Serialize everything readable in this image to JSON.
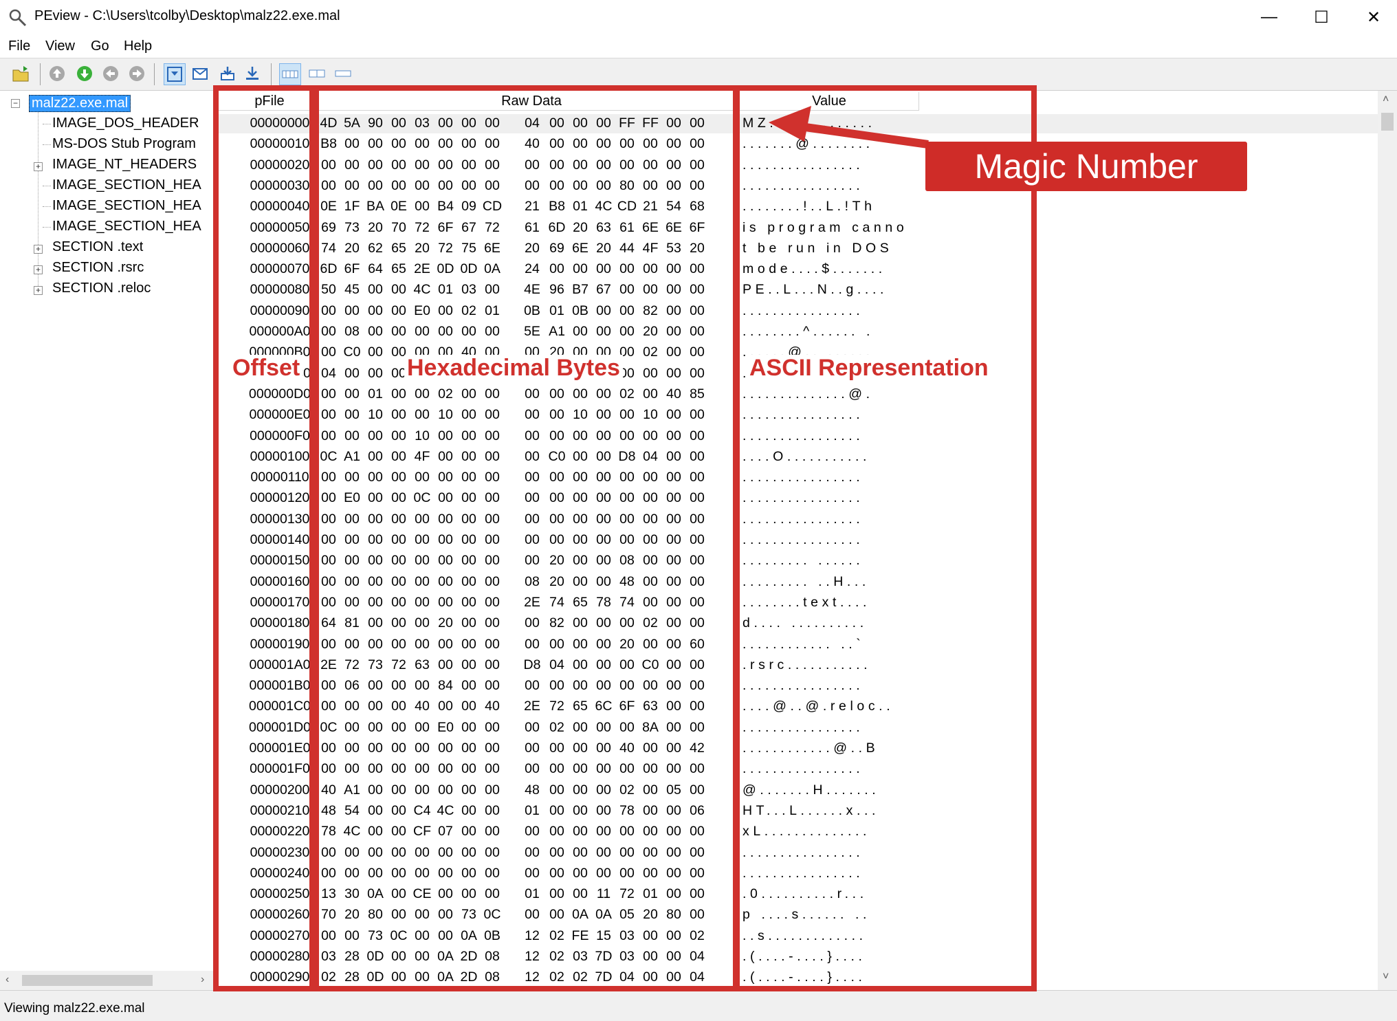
{
  "window": {
    "title": "PEview - C:\\Users\\tcolby\\Desktop\\malz22.exe.mal",
    "minimize_glyph": "—",
    "maximize_glyph": "☐",
    "close_glyph": "✕"
  },
  "menu": [
    "File",
    "View",
    "Go",
    "Help"
  ],
  "tree": [
    {
      "label": "malz22.exe.mal",
      "selected": true,
      "expander": "−"
    },
    {
      "label": "IMAGE_DOS_HEADER"
    },
    {
      "label": "MS-DOS Stub Program"
    },
    {
      "label": "IMAGE_NT_HEADERS",
      "expander": "+"
    },
    {
      "label": "IMAGE_SECTION_HEA"
    },
    {
      "label": "IMAGE_SECTION_HEA"
    },
    {
      "label": "IMAGE_SECTION_HEA"
    },
    {
      "label": "SECTION .text",
      "expander": "+"
    },
    {
      "label": "SECTION .rsrc",
      "expander": "+"
    },
    {
      "label": "SECTION .reloc",
      "expander": "+"
    }
  ],
  "columns": {
    "pfile": "pFile",
    "raw": "Raw Data",
    "value": "Value"
  },
  "rows": [
    [
      "00000000",
      "4D 5A 90 00 03 00 00 00 04 00 00 00 FF FF 00 00",
      "MZ.............."
    ],
    [
      "00000010",
      "B8 00 00 00 00 00 00 00 40 00 00 00 00 00 00 00",
      ".......@........"
    ],
    [
      "00000020",
      "00 00 00 00 00 00 00 00 00 00 00 00 00 00 00 00",
      "................"
    ],
    [
      "00000030",
      "00 00 00 00 00 00 00 00 00 00 00 00 80 00 00 00",
      "................"
    ],
    [
      "00000040",
      "0E 1F BA 0E 00 B4 09 CD 21 B8 01 4C CD 21 54 68",
      "........!..L.!Th"
    ],
    [
      "00000050",
      "69 73 20 70 72 6F 67 72 61 6D 20 63 61 6E 6E 6F",
      "is program canno"
    ],
    [
      "00000060",
      "74 20 62 65 20 72 75 6E 20 69 6E 20 44 4F 53 20",
      "t be run in DOS "
    ],
    [
      "00000070",
      "6D 6F 64 65 2E 0D 0D 0A 24 00 00 00 00 00 00 00",
      "mode....$......."
    ],
    [
      "00000080",
      "50 45 00 00 4C 01 03 00 4E 96 B7 67 00 00 00 00",
      "PE..L...N..g...."
    ],
    [
      "00000090",
      "00 00 00 00 E0 00 02 01 0B 01 0B 00 00 82 00 00",
      "................"
    ],
    [
      "000000A0",
      "00 08 00 00 00 00 00 00 5E A1 00 00 00 20 00 00",
      "........^...... ."
    ],
    [
      "000000B0",
      "00 C0 00 00 00 00 40 00 00 20 00 00 00 02 00 00",
      "......@.. ......"
    ],
    [
      "000000C0",
      "04 00 00 00 00 00 00 00 04 00 00 00 00 00 00 00",
      "................"
    ],
    [
      "000000D0",
      "00 00 01 00 00 02 00 00 00 00 00 00 02 00 40 85",
      "..............@."
    ],
    [
      "000000E0",
      "00 00 10 00 00 10 00 00 00 00 10 00 00 10 00 00",
      "................"
    ],
    [
      "000000F0",
      "00 00 00 00 10 00 00 00 00 00 00 00 00 00 00 00",
      "................"
    ],
    [
      "00000100",
      "0C A1 00 00 4F 00 00 00 00 C0 00 00 D8 04 00 00",
      "....O..........."
    ],
    [
      "00000110",
      "00 00 00 00 00 00 00 00 00 00 00 00 00 00 00 00",
      "................"
    ],
    [
      "00000120",
      "00 E0 00 00 0C 00 00 00 00 00 00 00 00 00 00 00",
      "................"
    ],
    [
      "00000130",
      "00 00 00 00 00 00 00 00 00 00 00 00 00 00 00 00",
      "................"
    ],
    [
      "00000140",
      "00 00 00 00 00 00 00 00 00 00 00 00 00 00 00 00",
      "................"
    ],
    [
      "00000150",
      "00 00 00 00 00 00 00 00 00 20 00 00 08 00 00 00",
      "......... ......"
    ],
    [
      "00000160",
      "00 00 00 00 00 00 00 00 08 20 00 00 48 00 00 00",
      "......... ..H..."
    ],
    [
      "00000170",
      "00 00 00 00 00 00 00 00 2E 74 65 78 74 00 00 00",
      "........text...."
    ],
    [
      "00000180",
      "64 81 00 00 00 20 00 00 00 82 00 00 00 02 00 00",
      "d.... .........."
    ],
    [
      "00000190",
      "00 00 00 00 00 00 00 00 00 00 00 00 20 00 00 60",
      "............ ..`"
    ],
    [
      "000001A0",
      "2E 72 73 72 63 00 00 00 D8 04 00 00 00 C0 00 00",
      ".rsrc..........."
    ],
    [
      "000001B0",
      "00 06 00 00 00 84 00 00 00 00 00 00 00 00 00 00",
      "................"
    ],
    [
      "000001C0",
      "00 00 00 00 40 00 00 40 2E 72 65 6C 6F 63 00 00",
      "....@..@.reloc.."
    ],
    [
      "000001D0",
      "0C 00 00 00 00 E0 00 00 00 02 00 00 00 8A 00 00",
      "................"
    ],
    [
      "000001E0",
      "00 00 00 00 00 00 00 00 00 00 00 00 40 00 00 42",
      "............@..B"
    ],
    [
      "000001F0",
      "00 00 00 00 00 00 00 00 00 00 00 00 00 00 00 00",
      "................"
    ],
    [
      "00000200",
      "40 A1 00 00 00 00 00 00 48 00 00 00 02 00 05 00",
      "@.......H......."
    ],
    [
      "00000210",
      "48 54 00 00 C4 4C 00 00 01 00 00 00 78 00 00 06",
      "HT...L......x..."
    ],
    [
      "00000220",
      "78 4C 00 00 CF 07 00 00 00 00 00 00 00 00 00 00",
      "xL.............."
    ],
    [
      "00000230",
      "00 00 00 00 00 00 00 00 00 00 00 00 00 00 00 00",
      "................"
    ],
    [
      "00000240",
      "00 00 00 00 00 00 00 00 00 00 00 00 00 00 00 00",
      "................"
    ],
    [
      "00000250",
      "13 30 0A 00 CE 00 00 00 01 00 00 11 72 01 00 00",
      ".0..........r..."
    ],
    [
      "00000260",
      "70 20 80 00 00 00 73 0C 00 00 0A 0A 05 20 80 00",
      "p ....s...... .."
    ],
    [
      "00000270",
      "00 00 73 0C 00 00 0A 0B 12 02 FE 15 03 00 00 02",
      "..s............."
    ],
    [
      "00000280",
      "03 28 0D 00 00 0A 2D 08 12 02 03 7D 03 00 00 04",
      ".(....-....}...."
    ],
    [
      "00000290",
      "02 28 0D 00 00 0A 2D 08 12 02 02 7D 04 00 00 04",
      ".(....-....}...."
    ]
  ],
  "annotations": {
    "offset": "Offset",
    "hex": "Hexadecimal Bytes",
    "ascii": "ASCII Representation",
    "magic": "Magic Number"
  },
  "status": "Viewing malz22.exe.mal",
  "colors": {
    "annotation_red": "#d0312d",
    "selection_blue": "#3399ff"
  }
}
